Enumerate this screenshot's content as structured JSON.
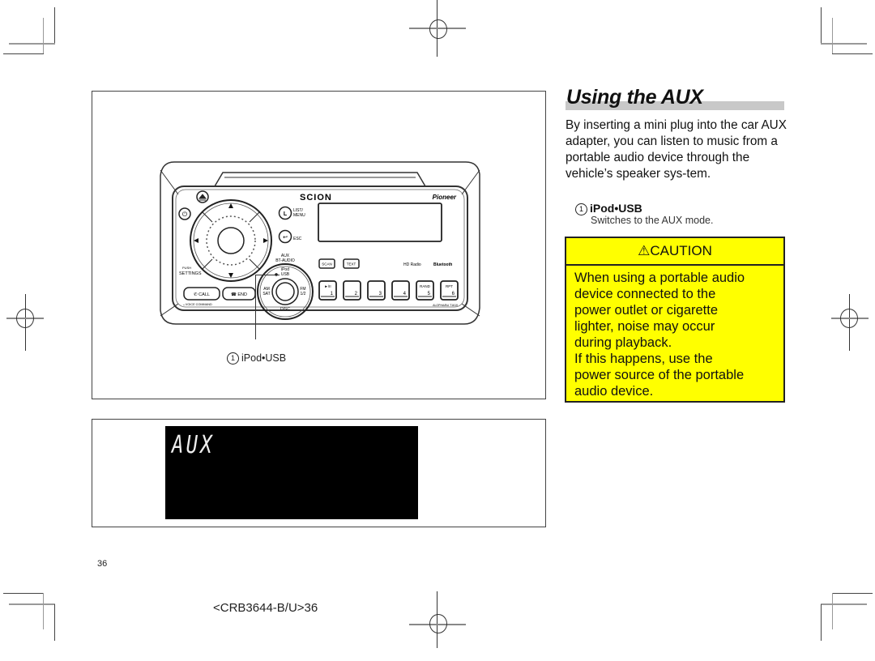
{
  "heading": "Using the AUX",
  "intro": "By inserting a mini plug into the car AUX adapter, you can listen to music from a portable audio device through the vehicle’s speaker sys-tem.",
  "item": {
    "number": "1",
    "title": "iPod•USB",
    "description": "Switches to the AUX mode."
  },
  "caution": {
    "icon": "warning-triangle-icon",
    "title": "CAUTION",
    "lines": [
      "When using a portable audio",
      "device connected to the",
      "power outlet or cigarette",
      "lighter, noise may occur",
      "during playback.",
      "If this happens, use the",
      "power source of the portable",
      "audio device."
    ]
  },
  "figure": {
    "callout_number": "1",
    "callout_label": "iPod•USB",
    "brand_left": "SCION",
    "brand_right": "Pioneer",
    "labels": {
      "list_menu": "LIST/ MENU",
      "list_key": "L",
      "esc": "ESC",
      "aux_bt": "AUX BT-AUDIO",
      "ipod_usb": "iPod USB",
      "am_sat": "AM SAT",
      "fm": "FM 1/2",
      "disc": "DISC",
      "push_settings": "PUSH SETTINGS",
      "call": "CALL",
      "end": "END",
      "voice_command": "VOICE COMMAND",
      "scan": "SCAN",
      "text": "TEXT",
      "hd_radio": "HD Radio",
      "bluetooth": "Bluetooth",
      "model": "ALOPHA/BU T1619"
    },
    "presets": [
      {
        "top": "►/II",
        "num": "1"
      },
      {
        "top": "",
        "num": "2"
      },
      {
        "top": "",
        "num": "3"
      },
      {
        "top": "",
        "num": "4"
      },
      {
        "top": "RAND",
        "num": "5"
      },
      {
        "top": "RPT",
        "num": "6"
      }
    ]
  },
  "display": {
    "text": "AUX"
  },
  "footer": {
    "page_number": "36",
    "doc_code": "<CRB3644-B/U>36"
  }
}
